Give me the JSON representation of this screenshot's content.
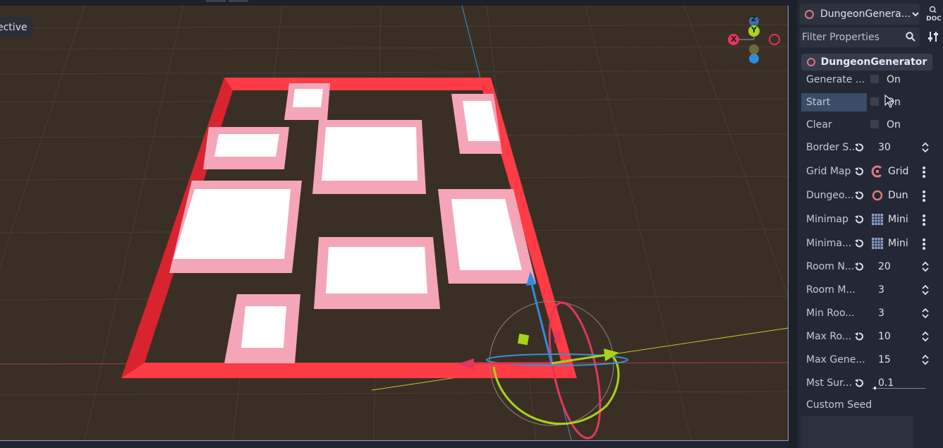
{
  "viewport": {
    "view_mode_label": "ective",
    "gizmo": {
      "x_label": "X",
      "y_label": "Y",
      "z_label": "Z"
    }
  },
  "inspector": {
    "node_name": "DungeonGenera...",
    "doc_label": "DOC",
    "filter_placeholder": "Filter Properties",
    "section_title": "DungeonGenerator",
    "properties": [
      {
        "label": "Generate ...",
        "kind": "check",
        "value": "On"
      },
      {
        "label": "Start",
        "kind": "check",
        "value": "On"
      },
      {
        "label": "Clear",
        "kind": "check",
        "value": "On"
      },
      {
        "label": "Border S...",
        "kind": "spin",
        "value": "30"
      },
      {
        "label": "Grid Map",
        "kind": "resource",
        "value": "Grid",
        "icon": "gridmap-icon"
      },
      {
        "label": "Dungeo...",
        "kind": "resource",
        "value": "Dun",
        "icon": "node-circle-icon"
      },
      {
        "label": "Minimap",
        "kind": "resource",
        "value": "Mini",
        "icon": "tilemap-icon"
      },
      {
        "label": "Minima...",
        "kind": "resource",
        "value": "Mini",
        "icon": "tilemap-icon"
      },
      {
        "label": "Room N...",
        "kind": "spin",
        "value": "20"
      },
      {
        "label": "Room M...",
        "kind": "spin",
        "value": "3"
      },
      {
        "label": "Min Roo...",
        "kind": "spin",
        "value": "3"
      },
      {
        "label": "Max Ro...",
        "kind": "spin",
        "value": "10"
      },
      {
        "label": "Max Gene...",
        "kind": "spin",
        "value": "15"
      },
      {
        "label": "Mst Sur...",
        "kind": "slider",
        "value": "0.1"
      },
      {
        "label": "Custom Seed",
        "kind": "text",
        "value": ""
      }
    ],
    "colors": {
      "accent": "#e2777e",
      "highlight": "#3a4c66"
    }
  }
}
